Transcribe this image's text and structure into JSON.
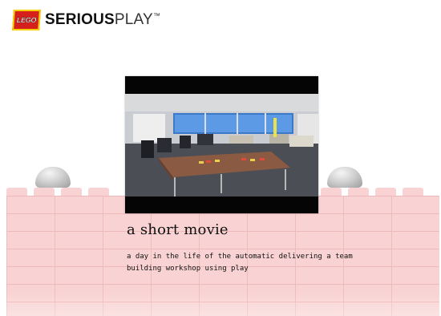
{
  "brand": {
    "logo_text": "LEGO",
    "name_bold": "SERIOUS",
    "name_light": "PLAY",
    "trademark": "™",
    "logo_color": "#d6201c"
  },
  "video": {
    "title": "a short movie",
    "description": "a day in the life of the automatic delivering a team building workshop using play"
  },
  "colors": {
    "wall": "#f9d3d3",
    "wall_lines": "#eeb9b9"
  }
}
